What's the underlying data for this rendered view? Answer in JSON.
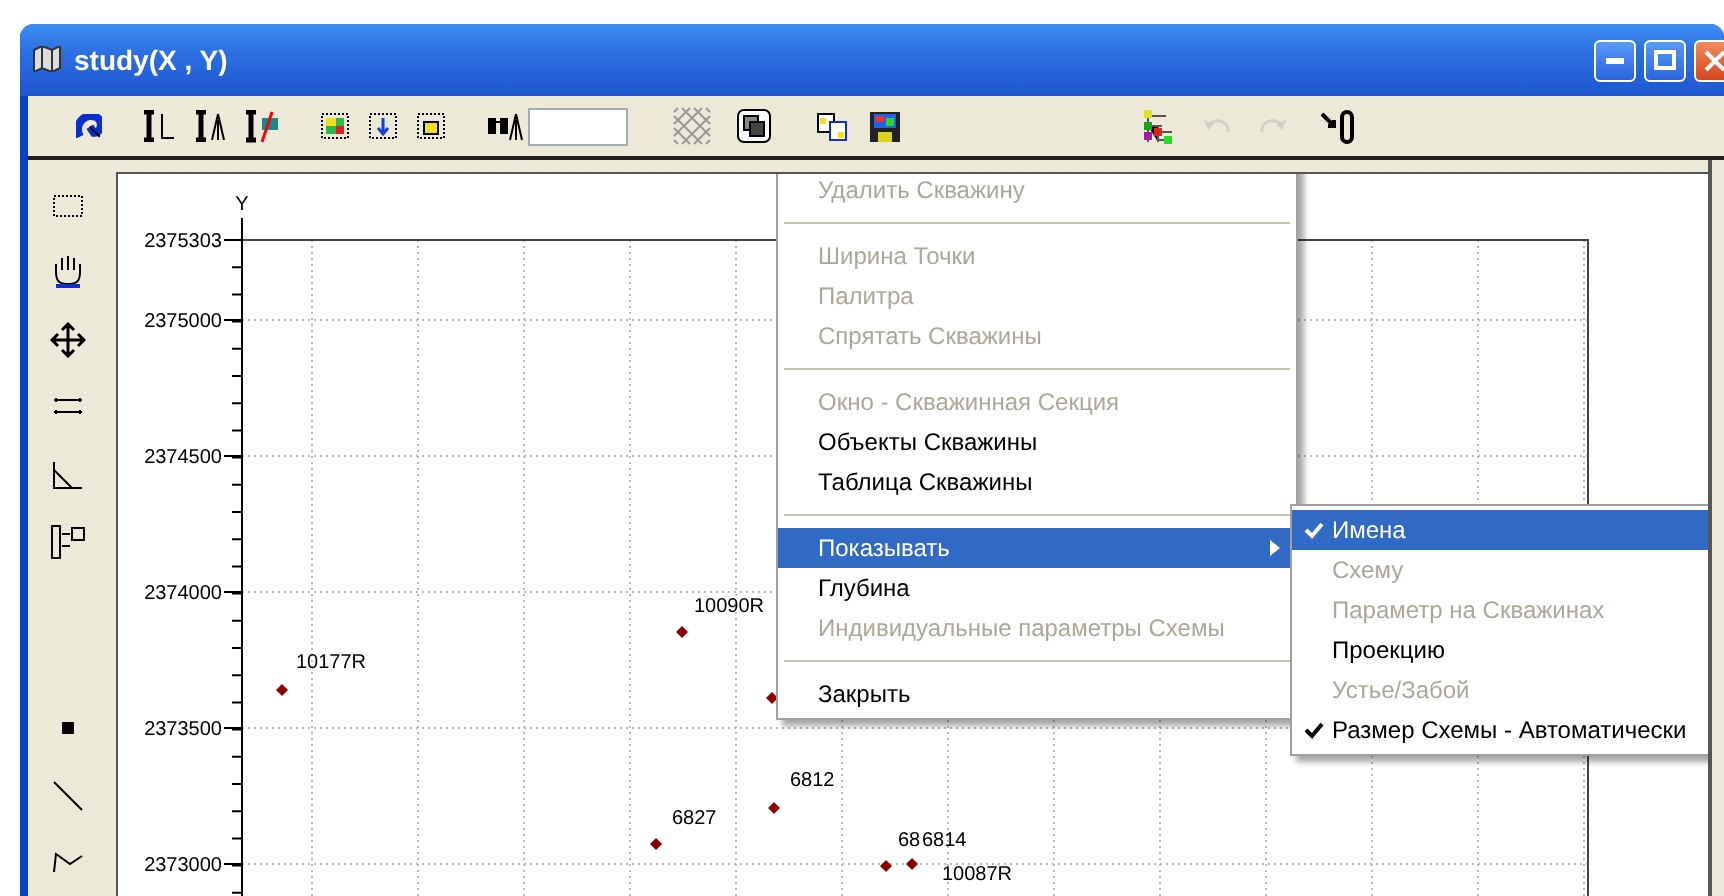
{
  "window": {
    "title": "study(X , Y)"
  },
  "toolbar": {
    "buttons": [
      {
        "kind": "swirl",
        "disabled": false
      },
      {
        "kind": "wrench-axis",
        "disabled": false
      },
      {
        "kind": "wrench-well",
        "disabled": false
      },
      {
        "kind": "wrench-slash",
        "disabled": false
      },
      {
        "kind": "frame-color",
        "disabled": false
      },
      {
        "kind": "frame-down",
        "disabled": false
      },
      {
        "kind": "frame-cube",
        "disabled": false
      },
      {
        "kind": "binoculars",
        "disabled": false
      },
      {
        "kind": "field"
      },
      {
        "kind": "hatch",
        "disabled": false
      },
      {
        "kind": "layers",
        "disabled": false
      },
      {
        "kind": "copy",
        "disabled": false
      },
      {
        "kind": "save",
        "disabled": false
      },
      {
        "kind": "tree",
        "disabled": false
      },
      {
        "kind": "undo",
        "disabled": true
      },
      {
        "kind": "redo",
        "disabled": true
      },
      {
        "kind": "pin",
        "disabled": false
      }
    ]
  },
  "side_toolbar": {
    "tools": [
      {
        "kind": "select"
      },
      {
        "kind": "hand"
      },
      {
        "kind": "move"
      },
      {
        "kind": "ruler"
      },
      {
        "kind": "angle"
      },
      {
        "kind": "insert"
      },
      {
        "kind": "point"
      },
      {
        "kind": "line"
      },
      {
        "kind": "polyline"
      }
    ]
  },
  "chart": {
    "axis_label": "Y",
    "y_ticks": [
      "2375303",
      "2375000",
      "2374500",
      "2374000",
      "2373500",
      "2373000"
    ],
    "wells": [
      {
        "label": "10177R"
      },
      {
        "label": "10090R"
      },
      {
        "label": "6812"
      },
      {
        "label": "6827"
      },
      {
        "label": "68"
      },
      {
        "label": "6814"
      },
      {
        "label": "10087R"
      }
    ]
  },
  "context_menu": {
    "items": [
      {
        "kind": "item",
        "label": "Удалить Скважину",
        "disabled": true,
        "selected": false
      },
      {
        "kind": "separator"
      },
      {
        "kind": "item",
        "label": "Ширина Точки",
        "disabled": true,
        "selected": false
      },
      {
        "kind": "item",
        "label": "Палитра",
        "disabled": true,
        "selected": false
      },
      {
        "kind": "item",
        "label": "Спрятать Скважины",
        "disabled": true,
        "selected": false
      },
      {
        "kind": "separator"
      },
      {
        "kind": "item",
        "label": "Окно - Скважинная Секция",
        "disabled": true,
        "selected": false
      },
      {
        "kind": "item",
        "label": "Объекты Скважины",
        "disabled": false,
        "selected": false
      },
      {
        "kind": "item",
        "label": "Таблица Скважины",
        "disabled": false,
        "selected": false
      },
      {
        "kind": "separator"
      },
      {
        "kind": "submenu",
        "label": "Показывать",
        "disabled": false,
        "selected": true
      },
      {
        "kind": "item",
        "label": "Глубина",
        "disabled": false,
        "selected": false
      },
      {
        "kind": "item",
        "label": "Индивидуальные параметры Схемы",
        "disabled": true,
        "selected": false
      },
      {
        "kind": "separator"
      },
      {
        "kind": "item",
        "label": "Закрыть",
        "disabled": false,
        "selected": false
      }
    ]
  },
  "submenu": {
    "items": [
      {
        "label": "Имена",
        "checked": true,
        "disabled": false,
        "selected": true
      },
      {
        "label": "Схему",
        "checked": false,
        "disabled": true,
        "selected": false
      },
      {
        "label": "Параметр на Скважинах",
        "checked": false,
        "disabled": true,
        "selected": false
      },
      {
        "label": "Проекцию",
        "checked": false,
        "disabled": false,
        "selected": false
      },
      {
        "label": "Устье/Забой",
        "checked": false,
        "disabled": true,
        "selected": false
      },
      {
        "label": "Размер Схемы - Автоматически",
        "checked": true,
        "disabled": false,
        "selected": false
      }
    ]
  }
}
